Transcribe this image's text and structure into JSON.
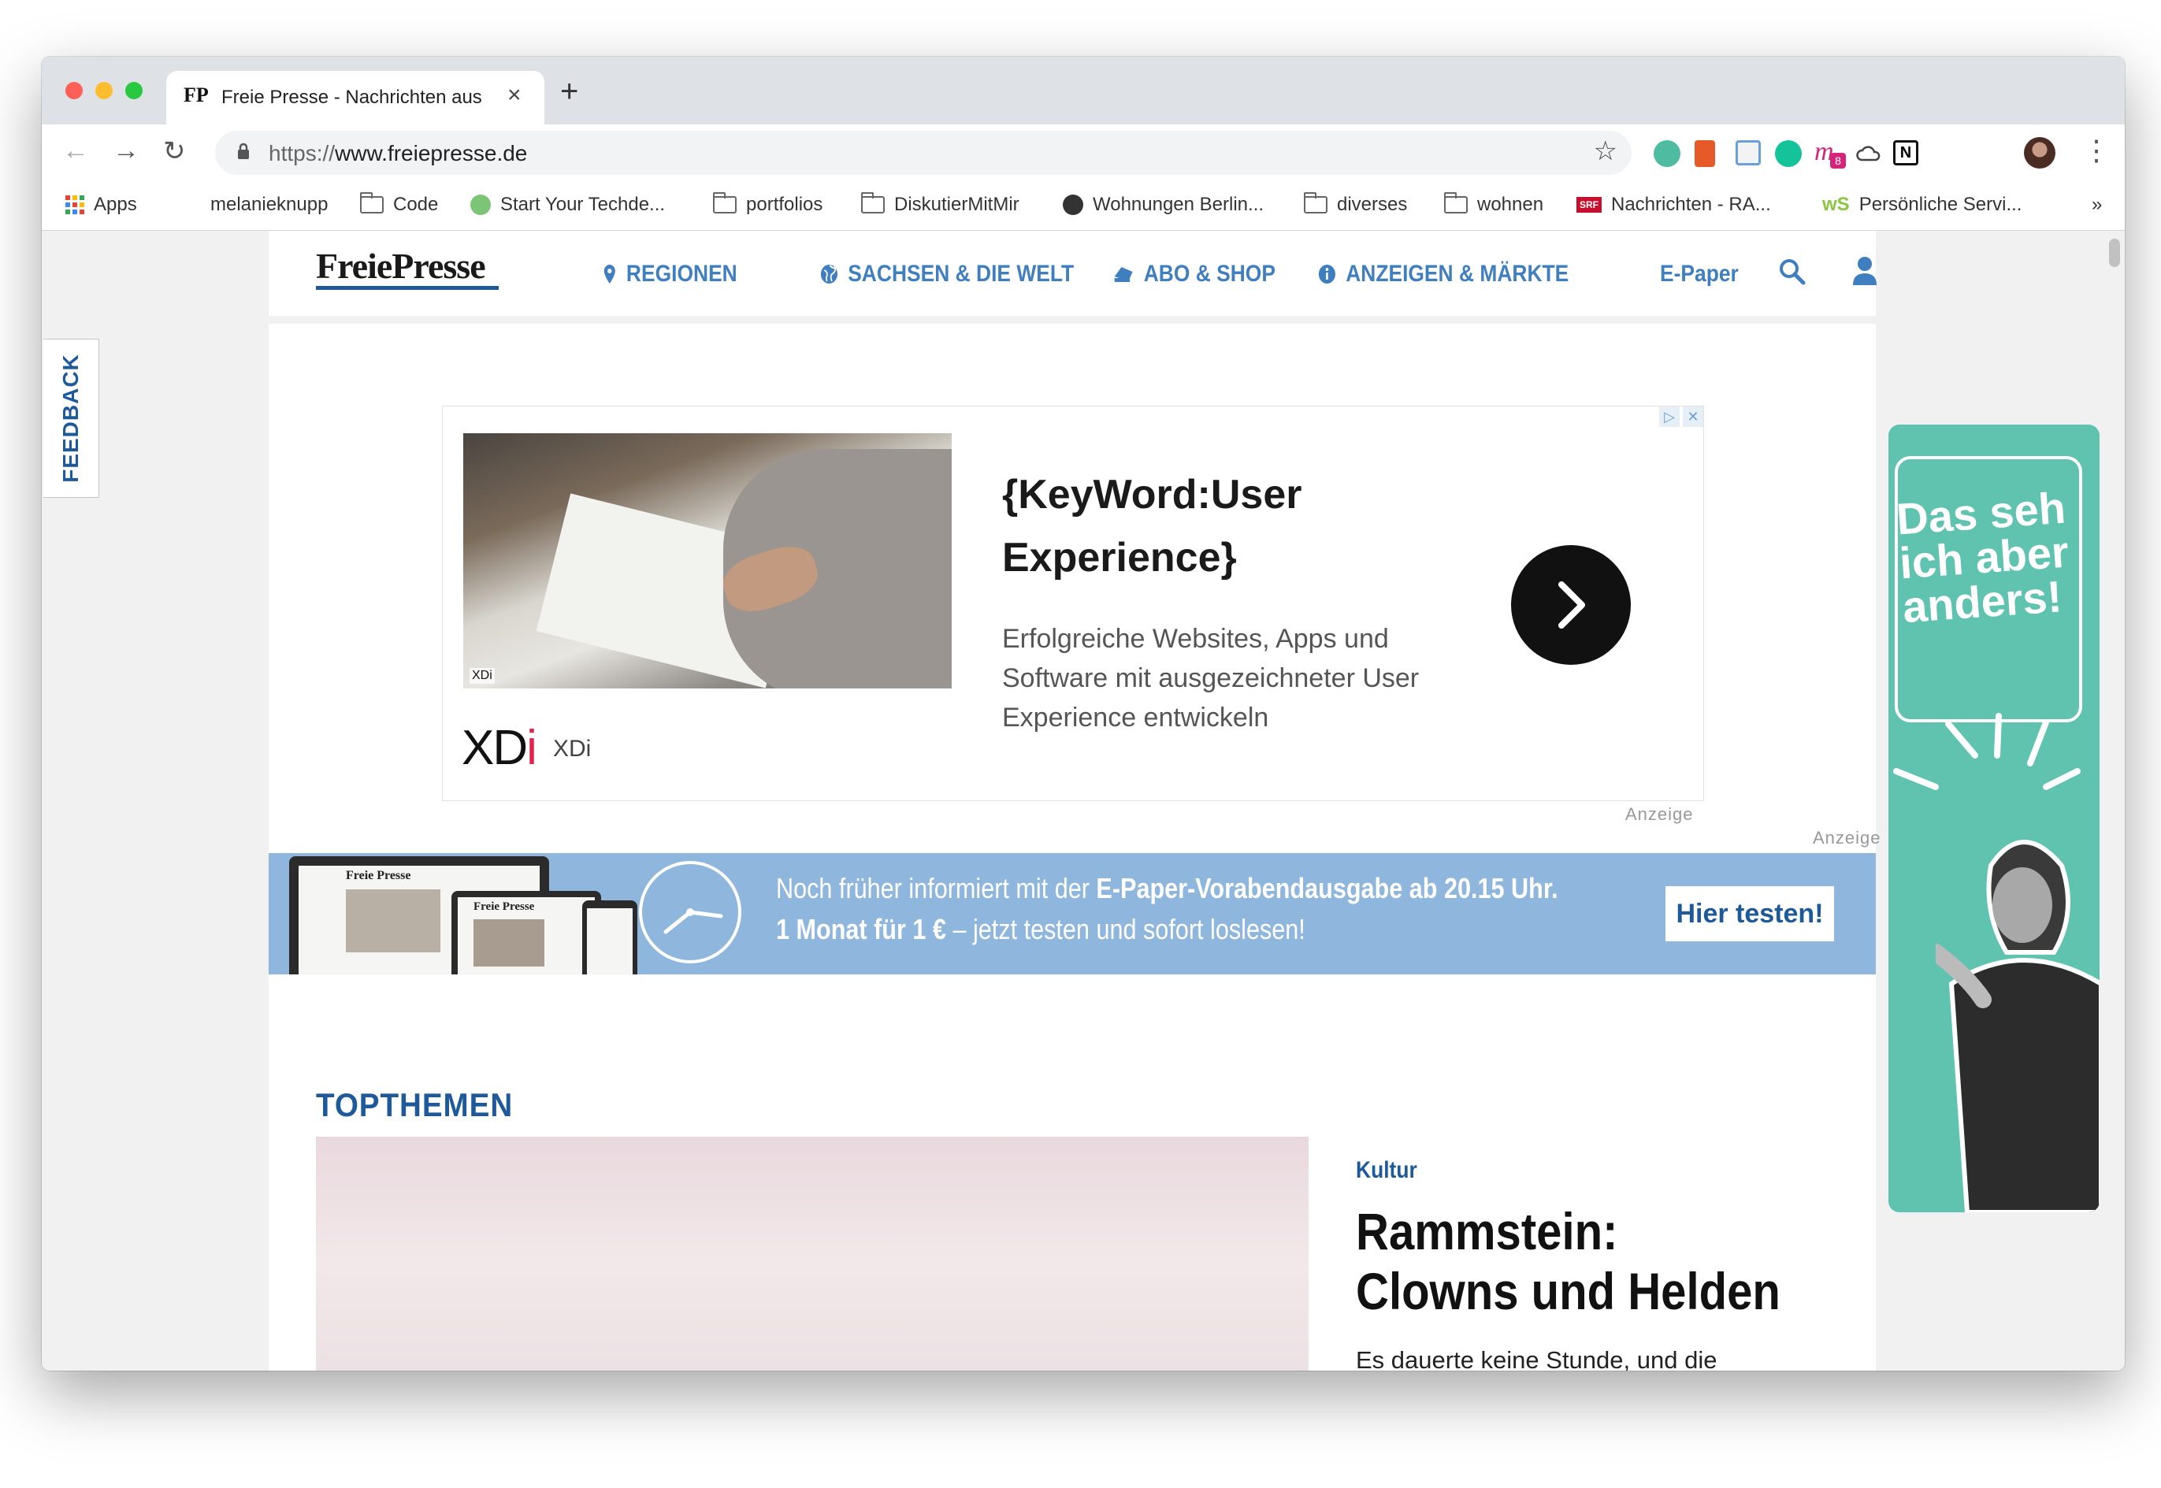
{
  "browser": {
    "tab": {
      "favicon": "FP",
      "title": "Freie Presse - Nachrichten aus",
      "close": "×"
    },
    "new_tab": "+",
    "nav": {
      "back": "←",
      "forward": "→",
      "reload": "↻"
    },
    "address": {
      "scheme": "https://",
      "host": "www.freiepresse.de"
    },
    "star": "☆",
    "menu": "⋮",
    "extensions": [
      {
        "name": "extension-round-icon",
        "color": "#4dbca0"
      },
      {
        "name": "office-extension-icon",
        "color": "#e65a2a"
      },
      {
        "name": "ext-red-badge-icon",
        "color": "#d8453b"
      },
      {
        "name": "grammarly-icon",
        "color": "#15c39a"
      },
      {
        "name": "m-extension-icon",
        "color": "#d4257a",
        "badge": "8"
      },
      {
        "name": "cloud-icon",
        "color": "#555555"
      },
      {
        "name": "notion-icon",
        "color": "#111111"
      }
    ],
    "bookmarks": [
      {
        "label": "Apps",
        "icon": "apps-grid-icon"
      },
      {
        "label": "melanieknupp",
        "icon": "none"
      },
      {
        "label": "Code",
        "icon": "folder-icon"
      },
      {
        "label": "Start Your Techde...",
        "icon": "techde-icon"
      },
      {
        "label": "portfolios",
        "icon": "folder-icon"
      },
      {
        "label": "DiskutierMitMir",
        "icon": "folder-icon"
      },
      {
        "label": "Wohnungen Berlin...",
        "icon": "globe-icon"
      },
      {
        "label": "diverses",
        "icon": "folder-icon"
      },
      {
        "label": "wohnen",
        "icon": "folder-icon"
      },
      {
        "label": "Nachrichten - RA...",
        "icon": "srf-icon"
      },
      {
        "label": "Persönliche Servi...",
        "icon": "ws-icon"
      }
    ],
    "bookmarks_overflow": "»"
  },
  "page": {
    "feedback": "FEEDBACK",
    "logo": "FreiePresse",
    "nav": [
      {
        "label": "REGIONEN",
        "icon": "location-pin-icon"
      },
      {
        "label": "SACHSEN & DIE WELT",
        "icon": "globe-icon"
      },
      {
        "label": "ABO & SHOP",
        "icon": "cart-icon"
      },
      {
        "label": "ANZEIGEN & MÄRKTE",
        "icon": "info-icon"
      }
    ],
    "epaper": "E-Paper",
    "ad": {
      "image_tag": "XDi",
      "headline": "{KeyWord:User Experience}",
      "description": "Erfolgreiche Websites, Apps und Software mit ausgezeichneter User Experience entwickeln",
      "brand_logo_a": "XD",
      "brand_logo_b": "i",
      "brand_name": "XDi",
      "choices": [
        "▷",
        "✕"
      ],
      "label": "Anzeige"
    },
    "anzeige_label": "Anzeige",
    "banner": {
      "line1_pre": "Noch früher informiert mit der ",
      "line1_bold": "E-Paper-Vorabendausgabe ab 20.15 Uhr.",
      "line2_bold": "1 Monat für 1 €",
      "line2_rest": " – jetzt testen und sofort loslesen!",
      "cta": "Hier testen!",
      "device_masthead": "Freie Presse"
    },
    "section_title": "TOPTHEMEN",
    "article": {
      "category": "Kultur",
      "title": "Rammstein: Clowns und Helden",
      "teaser": "Es dauerte keine Stunde, und die Rammstein- Konzerte am Mittwoch und"
    },
    "side_ad": {
      "text": "Das seh ich aber anders!"
    }
  }
}
